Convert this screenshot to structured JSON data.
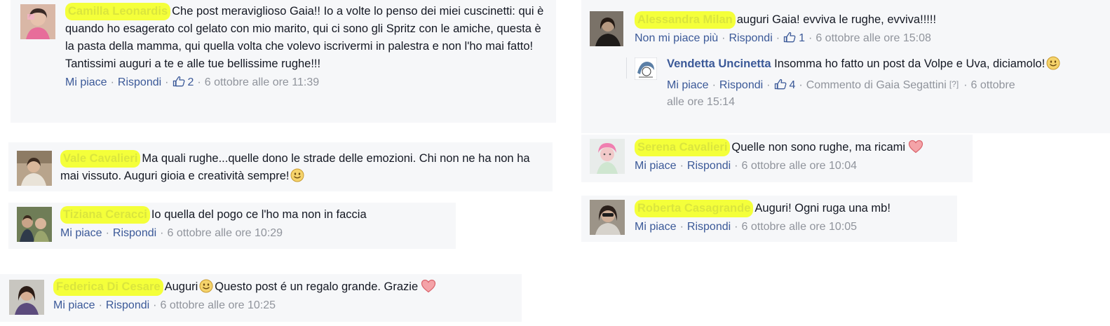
{
  "labels": {
    "like": "Mi piace",
    "unlike": "Non mi piace più",
    "reply": "Rispondi",
    "sep": "·",
    "qmark": "[?]"
  },
  "comments": [
    {
      "id": "c1",
      "author": "Camilla Leonardis",
      "text": "Che post meraviglioso Gaia!! Io a volte lo penso dei miei cuscinetti: qui è quando ho esagerato col gelato con mio marito, qui ci sono gli Spritz con le amiche, questa è la pasta della mamma, qui quella volta che volevo iscrivermi in palestra e non l'ho mai fatto! Tantissimi auguri a te e alle tue bellissime rughe!!!",
      "likes": "2",
      "time": "6 ottobre alle ore 11:39"
    },
    {
      "id": "c2",
      "author": "Vale Cavalieri",
      "text": "Ma quali rughe...quelle dono le strade delle emozioni. Chi non ne ha non ha mai vissuto. Auguri gioia e creatività sempre!"
    },
    {
      "id": "c3",
      "author": "Tiziana Ceracci",
      "text": "Io quella del pogo ce l'ho ma non in faccia",
      "time": "6 ottobre alle ore 10:29"
    },
    {
      "id": "c4",
      "author": "Federica Di Cesare",
      "text_a": "Auguri",
      "text_b": "Questo post é un regalo grande. Grazie",
      "time": "6 ottobre alle ore 10:25"
    },
    {
      "id": "c5",
      "author": "Alessandra Milan",
      "text": "auguri Gaia! evviva le rughe, evviva!!!!!",
      "likes": "1",
      "time": "6 ottobre alle ore 15:08"
    },
    {
      "id": "c6",
      "author": "Vendetta Uncinetta",
      "text": "Insomma ho fatto un post da Volpe e Uva, diciamolo!",
      "likes": "4",
      "edited_by": "Commento di Gaia Segattini",
      "time_a": "6 ottobre",
      "time_b": "alle ore 15:14"
    },
    {
      "id": "c7",
      "author": "Serena Cavalieri",
      "text": "Quelle non sono rughe, ma ricami",
      "time": "6 ottobre alle ore 10:04"
    },
    {
      "id": "c8",
      "author": "Roberta Casagrande",
      "text": "Auguri! Ogni ruga una mb!",
      "time": "6 ottobre alle ore 10:05"
    }
  ],
  "colors": {
    "link": "#3b5998",
    "meta": "#90949c",
    "card_bg": "#f6f7f9",
    "highlight": "#f4ff3a",
    "heart": "#f1878d",
    "smiley": "#f5d36b"
  }
}
